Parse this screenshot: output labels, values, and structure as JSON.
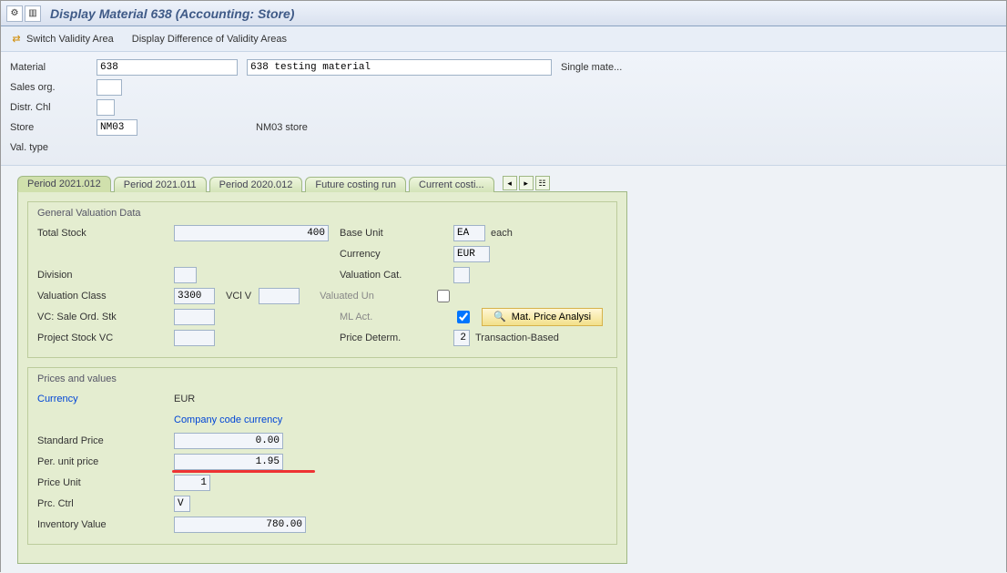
{
  "titlebar": {
    "icon_settings": "⚙",
    "icon_list": "▥",
    "title": "Display Material 638 (Accounting: Store)"
  },
  "toolbar": {
    "switch_validity": "Switch Validity Area",
    "display_diff": "Display Difference of Validity Areas"
  },
  "org": {
    "material_lbl": "Material",
    "material": "638",
    "material_desc": "638 testing material",
    "material_type_text": "Single mate...",
    "sales_org_lbl": "Sales org.",
    "sales_org": "",
    "distr_chl_lbl": "Distr. Chl",
    "distr_chl": "",
    "store_lbl": "Store",
    "store": "NM03",
    "store_text": "NM03 store",
    "val_type_lbl": "Val. type",
    "val_type": ""
  },
  "tabs": {
    "items": [
      {
        "label": "Period 2021.012"
      },
      {
        "label": "Period 2021.011"
      },
      {
        "label": "Period 2020.012"
      },
      {
        "label": "Future costing run"
      },
      {
        "label": "Current costi..."
      }
    ],
    "active_index": 0
  },
  "valuation": {
    "group_title": "General Valuation Data",
    "total_stock_lbl": "Total Stock",
    "total_stock": "400",
    "base_unit_lbl": "Base Unit",
    "base_unit": "EA",
    "base_unit_text": "each",
    "currency_lbl": "Currency",
    "currency": "EUR",
    "division_lbl": "Division",
    "division": "",
    "valuation_cat_lbl": "Valuation Cat.",
    "valuation_cat": "",
    "valuation_class_lbl": "Valuation Class",
    "valuation_class": "3300",
    "vcl_v_lbl": "VCl V",
    "vcl_v": "",
    "valuated_un_lbl": "Valuated Un",
    "valuated_un_checked": false,
    "vc_sale_ord_stk_lbl": "VC: Sale Ord. Stk",
    "vc_sale_ord_stk": "",
    "ml_act_lbl": "ML Act.",
    "ml_act_checked": true,
    "mat_price_analysis_btn": "Mat. Price Analysi",
    "project_stock_vc_lbl": "Project Stock VC",
    "project_stock_vc": "",
    "price_determ_lbl": "Price Determ.",
    "price_determ": "2",
    "price_determ_text": "Transaction-Based"
  },
  "prices": {
    "group_title": "Prices and values",
    "currency_lbl": "Currency",
    "currency_val": "EUR",
    "company_code_curr_lbl": "Company code currency",
    "standard_price_lbl": "Standard Price",
    "standard_price": "0.00",
    "per_unit_price_lbl": "Per. unit price",
    "per_unit_price": "1.95",
    "price_unit_lbl": "Price Unit",
    "price_unit": "1",
    "prc_ctrl_lbl": "Prc. Ctrl",
    "prc_ctrl": "V",
    "inventory_value_lbl": "Inventory Value",
    "inventory_value": "780.00"
  }
}
